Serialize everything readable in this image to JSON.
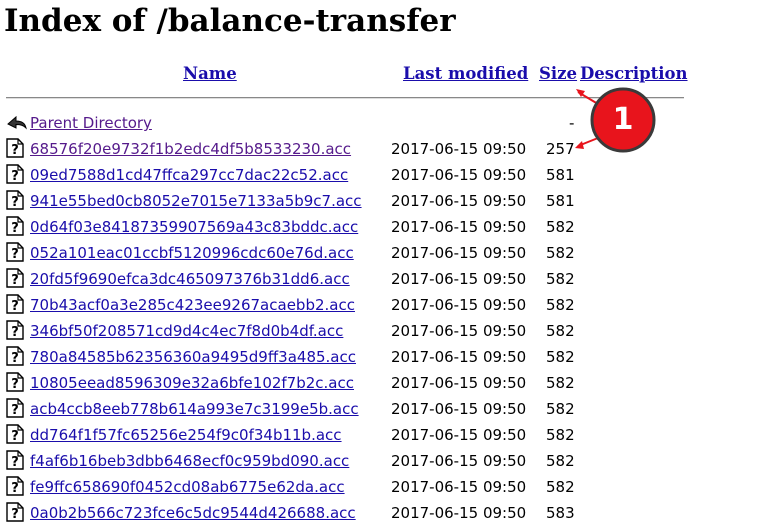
{
  "page": {
    "title": "Index of /balance-transfer"
  },
  "table": {
    "headers": {
      "name": "Name",
      "last_modified": "Last modified",
      "size": "Size",
      "description": "Description"
    },
    "parent": {
      "label": "Parent Directory",
      "size": "-"
    },
    "rows": [
      {
        "name": "68576f20e9732f1b2edc4df5b8533230.acc",
        "modified": "2017-06-15 09:50",
        "size": "257"
      },
      {
        "name": "09ed7588d1cd47ffca297cc7dac22c52.acc",
        "modified": "2017-06-15 09:50",
        "size": "581"
      },
      {
        "name": "941e55bed0cb8052e7015e7133a5b9c7.acc",
        "modified": "2017-06-15 09:50",
        "size": "581"
      },
      {
        "name": "0d64f03e84187359907569a43c83bddc.acc",
        "modified": "2017-06-15 09:50",
        "size": "582"
      },
      {
        "name": "052a101eac01ccbf5120996cdc60e76d.acc",
        "modified": "2017-06-15 09:50",
        "size": "582"
      },
      {
        "name": "20fd5f9690efca3dc465097376b31dd6.acc",
        "modified": "2017-06-15 09:50",
        "size": "582"
      },
      {
        "name": "70b43acf0a3e285c423ee9267acaebb2.acc",
        "modified": "2017-06-15 09:50",
        "size": "582"
      },
      {
        "name": "346bf50f208571cd9d4c4ec7f8d0b4df.acc",
        "modified": "2017-06-15 09:50",
        "size": "582"
      },
      {
        "name": "780a84585b62356360a9495d9ff3a485.acc",
        "modified": "2017-06-15 09:50",
        "size": "582"
      },
      {
        "name": "10805eead8596309e32a6bfe102f7b2c.acc",
        "modified": "2017-06-15 09:50",
        "size": "582"
      },
      {
        "name": "acb4ccb8eeb778b614a993e7c3199e5b.acc",
        "modified": "2017-06-15 09:50",
        "size": "582"
      },
      {
        "name": "dd764f1f57fc65256e254f9c0f34b11b.acc",
        "modified": "2017-06-15 09:50",
        "size": "582"
      },
      {
        "name": "f4af6b16beb3dbb6468ecf0c959bd090.acc",
        "modified": "2017-06-15 09:50",
        "size": "582"
      },
      {
        "name": "fe9ffc658690f0452cd08ab6775e62da.acc",
        "modified": "2017-06-15 09:50",
        "size": "582"
      },
      {
        "name": "0a0b2b566c723fce6c5dc9544d426688.acc",
        "modified": "2017-06-15 09:50",
        "size": "583"
      }
    ]
  },
  "annotation": {
    "badge_label": "1",
    "badge_color": "#e8141c"
  },
  "icons": {
    "parent": "back-arrow-icon",
    "file": "unknown-file-icon"
  }
}
